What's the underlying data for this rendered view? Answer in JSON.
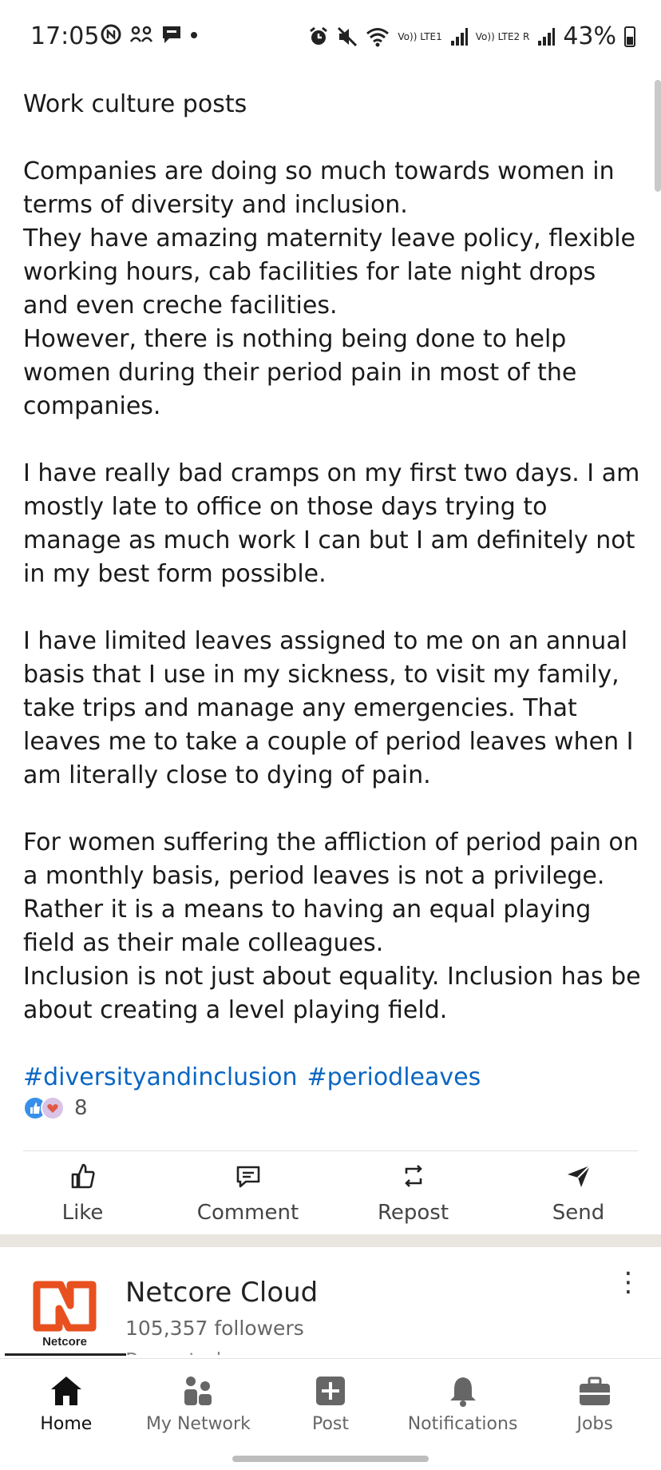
{
  "status_bar": {
    "time": "17:05",
    "battery": "43%",
    "sim1": "Vo)) LTE1",
    "sim2": "Vo)) LTE2 R"
  },
  "post": {
    "title": "Work culture posts",
    "paragraphs": [
      "Companies are doing so much towards women in terms of diversity and inclusion.\nThey have amazing maternity leave policy, flexible working hours, cab facilities for late night drops and even creche facilities.\nHowever, there is nothing being done to help women during their period pain in most of the companies.",
      "I have really bad cramps on my first two days. I am mostly late to office on those days trying to manage as much work I can but I am definitely not in my best form possible.",
      "I have limited leaves assigned to me on an annual basis that I use in my sickness,  to visit my family, take trips and manage any emergencies. That leaves me to take a couple of period leaves when I am literally close to dying of pain.",
      "For women suffering the affliction of period pain on a monthly basis, period leaves is not a privilege. Rather it is a means to having an equal playing field as their male colleagues.\nInclusion is not just about equality. Inclusion has be about creating a level playing field."
    ],
    "hashtags": [
      "#diversityandinclusion",
      "#periodleaves"
    ],
    "reaction_count": "8"
  },
  "actions": [
    {
      "label": "Like",
      "icon": "like-icon"
    },
    {
      "label": "Comment",
      "icon": "comment-icon"
    },
    {
      "label": "Repost",
      "icon": "repost-icon"
    },
    {
      "label": "Send",
      "icon": "send-icon"
    }
  ],
  "sponsored": {
    "logo_text": "Netcore",
    "company_name": "Netcore Cloud",
    "followers": "105,357 followers",
    "sub": "Promoted"
  },
  "bottom_nav": [
    {
      "label": "Home",
      "icon": "home-icon",
      "active": true
    },
    {
      "label": "My Network",
      "icon": "network-icon",
      "active": false
    },
    {
      "label": "Post",
      "icon": "post-icon",
      "active": false
    },
    {
      "label": "Notifications",
      "icon": "bell-icon",
      "active": false
    },
    {
      "label": "Jobs",
      "icon": "briefcase-icon",
      "active": false
    }
  ],
  "colors": {
    "link": "#0a66c2",
    "brand_orange": "#e8501f",
    "like_blue": "#378fe9"
  }
}
